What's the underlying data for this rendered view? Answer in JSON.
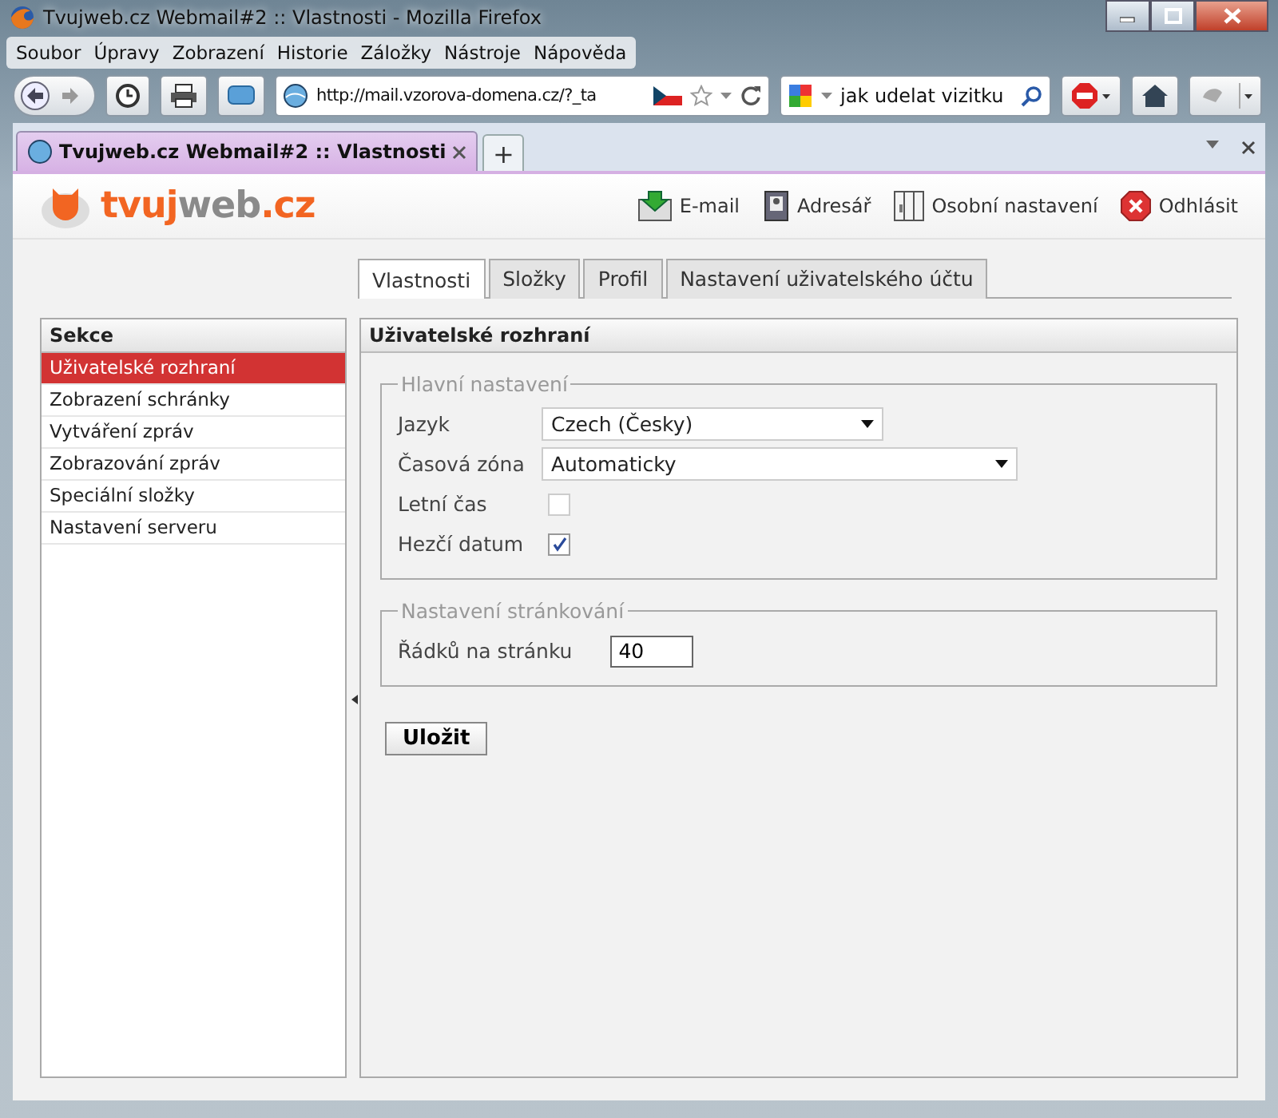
{
  "window": {
    "title": "Tvujweb.cz Webmail#2 :: Vlastnosti - Mozilla Firefox"
  },
  "menu": [
    "Soubor",
    "Úpravy",
    "Zobrazení",
    "Historie",
    "Záložky",
    "Nástroje",
    "Nápověda"
  ],
  "address_bar": {
    "value": "http://mail.vzorova-domena.cz/?_ta"
  },
  "search_field": {
    "value": "jak udelat vizitku"
  },
  "browser_tabs": [
    {
      "title": "Tvujweb.cz Webmail#2 :: Vlastnosti",
      "selected": true
    }
  ],
  "new_tab": "+",
  "logo": [
    {
      "text": "tvuj",
      "color": "#f26522"
    },
    {
      "text": "web",
      "color": "#8a8a8a"
    },
    {
      "text": ".cz",
      "color": "#f26522"
    }
  ],
  "nav_links": [
    {
      "label": "E-mail",
      "kind": "mail"
    },
    {
      "label": "Adresář",
      "kind": "book"
    },
    {
      "label": "Osobní nastavení",
      "kind": "panel"
    },
    {
      "label": "Odhlásit",
      "kind": "logout"
    }
  ],
  "tabs": [
    {
      "label": "Vlastnosti",
      "selected": true
    },
    {
      "label": "Složky",
      "selected": false
    },
    {
      "label": "Profil",
      "selected": false
    },
    {
      "label": "Nastavení uživatelského účtu",
      "selected": false
    }
  ],
  "sidebar": {
    "title": "Sekce",
    "items": [
      {
        "label": "Uživatelské rozhraní",
        "selected": true
      },
      {
        "label": "Zobrazení schránky",
        "selected": false
      },
      {
        "label": "Vytváření zpráv",
        "selected": false
      },
      {
        "label": "Zobrazování zpráv",
        "selected": false
      },
      {
        "label": "Speciální složky",
        "selected": false
      },
      {
        "label": "Nastavení serveru",
        "selected": false
      }
    ]
  },
  "panel": {
    "title": "Uživatelské rozhraní",
    "fieldsets": [
      {
        "legend": "Hlavní nastavení",
        "rows": [
          {
            "kind": "select",
            "label": "Jazyk",
            "value": "Czech (Česky)"
          },
          {
            "kind": "select",
            "label": "Časová zóna",
            "value": "Automaticky"
          },
          {
            "kind": "checkbox",
            "label": "Letní čas",
            "checked": false,
            "disabled": true
          },
          {
            "kind": "checkbox",
            "label": "Hezčí datum",
            "checked": true,
            "disabled": false
          }
        ]
      },
      {
        "legend": "Nastavení stránkování",
        "rows": [
          {
            "kind": "text",
            "label": "Řádků na stránku",
            "value": "40"
          }
        ]
      }
    ]
  },
  "save_button": "Uložit"
}
